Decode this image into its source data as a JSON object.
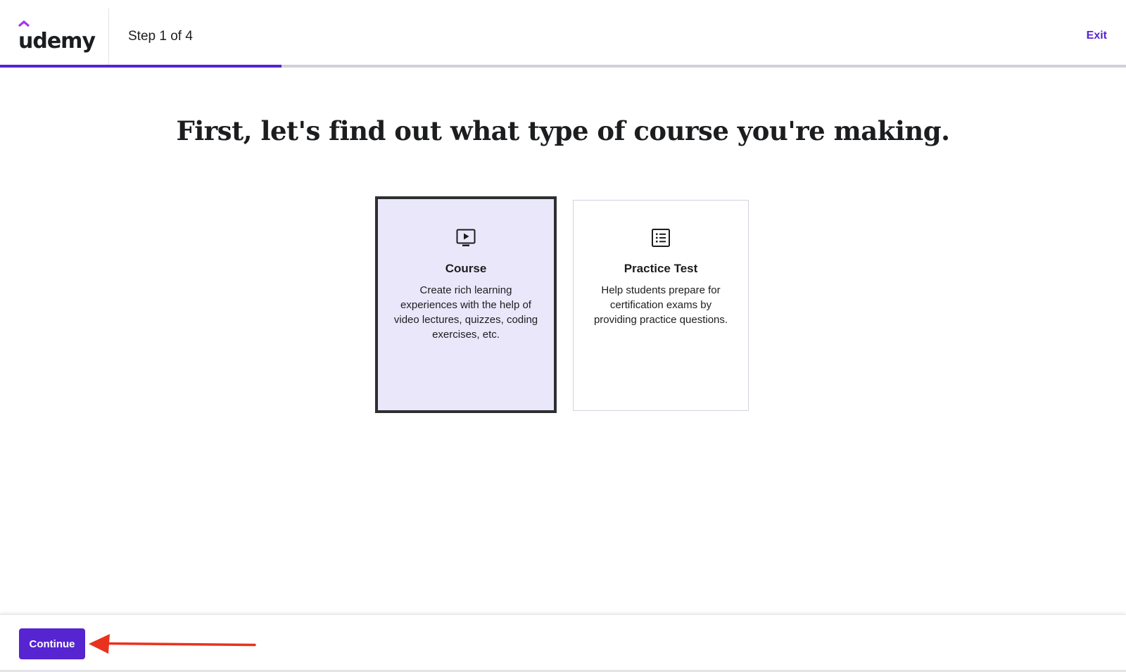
{
  "header": {
    "logo_text": "udemy",
    "step_label": "Step 1 of 4",
    "exit_label": "Exit",
    "progress": 0.25
  },
  "main": {
    "heading": "First, let's find out what type of course you're making.",
    "options": [
      {
        "title": "Course",
        "description": "Create rich learning experiences with the help of video lectures, quizzes, coding exercises, etc.",
        "icon": "video-play-icon",
        "selected": true
      },
      {
        "title": "Practice Test",
        "description": "Help students prepare for certification exams by providing practice questions.",
        "icon": "list-document-icon",
        "selected": false
      }
    ]
  },
  "footer": {
    "continue_label": "Continue"
  },
  "colors": {
    "brand": "#5624d0",
    "selected_card_bg": "#ebe7fb",
    "annotation_arrow": "#e8321e"
  }
}
